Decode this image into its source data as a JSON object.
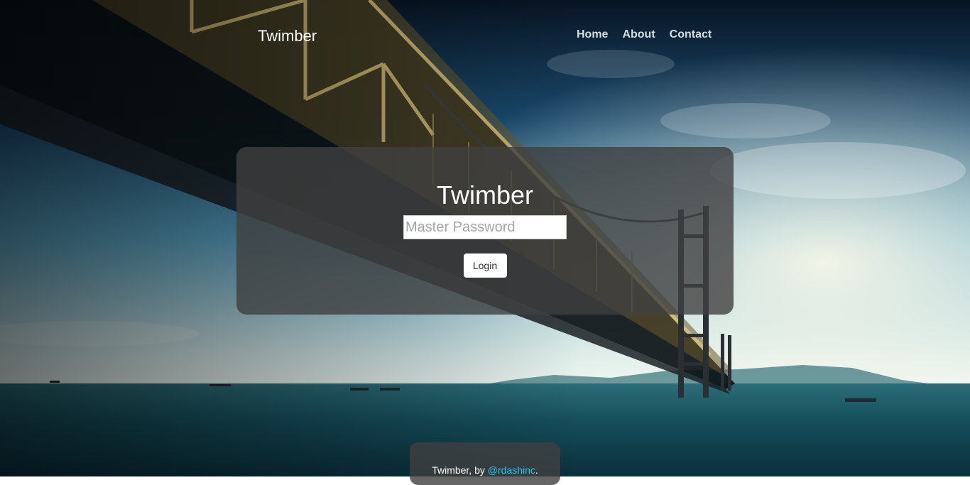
{
  "navbar": {
    "brand": "Twimber",
    "links": [
      "Home",
      "About",
      "Contact"
    ]
  },
  "login": {
    "title": "Twimber",
    "password_placeholder": "Master Password",
    "password_value": "",
    "button_label": "Login"
  },
  "footer": {
    "prefix": "Twimber, by ",
    "link_text": "@rdashinc",
    "suffix": "."
  },
  "colors": {
    "panel_bg": "#404040",
    "footer_link": "#2ac6f0",
    "nav_text": "#d8dde2"
  }
}
